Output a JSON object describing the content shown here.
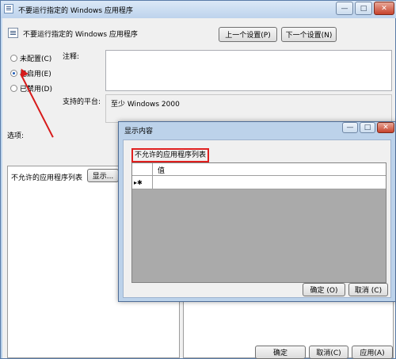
{
  "window": {
    "title": "不要运行指定的 Windows 应用程序",
    "minimize": "—",
    "maximize": "□",
    "close": "✕"
  },
  "policy": {
    "title": "不要运行指定的 Windows 应用程序",
    "prev_button": "上一个设置(P)",
    "next_button": "下一个设置(N)"
  },
  "state_options": [
    {
      "label": "未配置(C)",
      "selected": false
    },
    {
      "label": "已启用(E)",
      "selected": true
    },
    {
      "label": "已禁用(D)",
      "selected": false
    }
  ],
  "comment": {
    "label": "注释:",
    "value": ""
  },
  "platform": {
    "label": "支持的平台:",
    "value": "至少 Windows 2000"
  },
  "options": {
    "heading": "选项:",
    "item_label": "不允许的应用程序列表",
    "show_button": "显示..."
  },
  "footer": {
    "ok": "确定",
    "cancel": "取消(C)",
    "apply": "应用(A)"
  },
  "dialog": {
    "title": "显示内容",
    "minimize": "—",
    "maximize": "□",
    "close": "✕",
    "list_label": "不允许的应用程序列表",
    "column_header": "值",
    "row_marker": "▸✱",
    "ok": "确定 (O)",
    "cancel": "取消 (C)"
  },
  "colors": {
    "annotation": "#d71a1a",
    "close_button": "#c7422c",
    "selected_radio": "#1f5cb8"
  }
}
